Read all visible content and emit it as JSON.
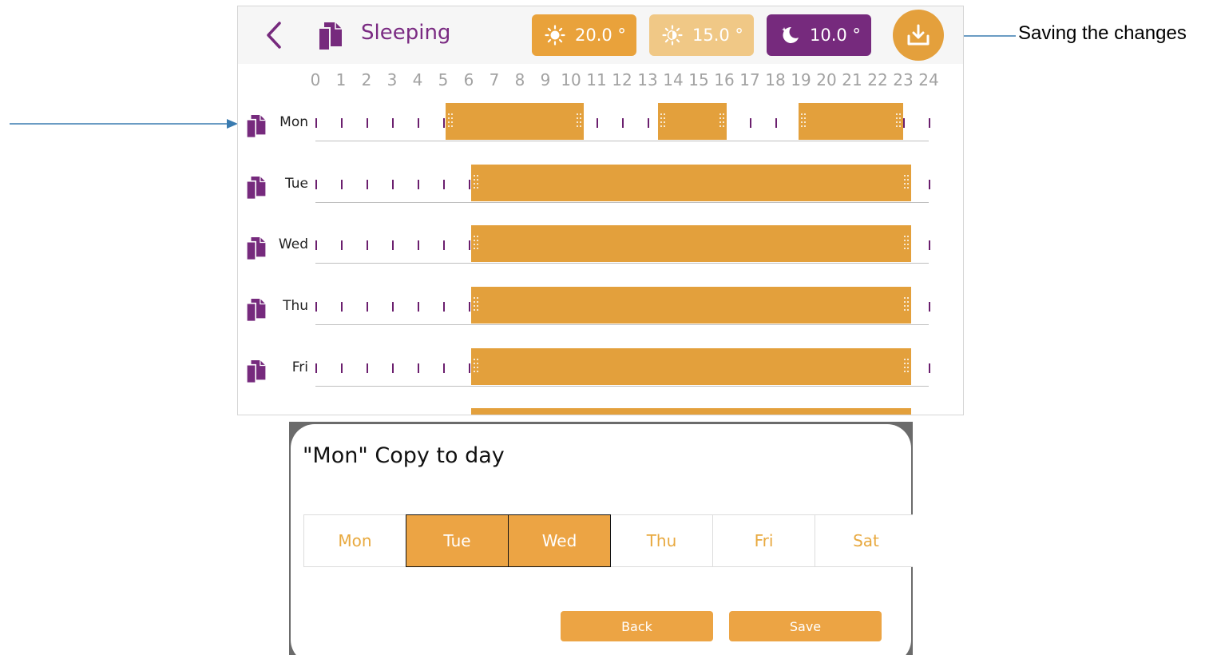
{
  "header": {
    "title": "Sleeping",
    "temps": [
      {
        "label": "20.0 °",
        "icon": "sun-icon",
        "color": "#e9a23b"
      },
      {
        "label": "15.0 °",
        "icon": "sun-dim-icon",
        "color": "#f0c886"
      },
      {
        "label": "10.0 °",
        "icon": "moon-icon",
        "color": "#762a7d"
      }
    ]
  },
  "hours": [
    "0",
    "1",
    "2",
    "3",
    "4",
    "5",
    "6",
    "7",
    "8",
    "9",
    "10",
    "11",
    "12",
    "13",
    "14",
    "15",
    "16",
    "17",
    "18",
    "19",
    "20",
    "21",
    "22",
    "23",
    "24"
  ],
  "days": [
    {
      "label": "Mon",
      "segments": [
        [
          5.1,
          10.5
        ],
        [
          13.4,
          16.1
        ],
        [
          18.9,
          23.0
        ]
      ]
    },
    {
      "label": "Tue",
      "segments": [
        [
          6.1,
          23.3
        ]
      ]
    },
    {
      "label": "Wed",
      "segments": [
        [
          6.1,
          23.3
        ]
      ]
    },
    {
      "label": "Thu",
      "segments": [
        [
          6.1,
          23.3
        ]
      ]
    },
    {
      "label": "Fri",
      "segments": [
        [
          6.1,
          23.3
        ]
      ]
    }
  ],
  "annotations": {
    "save": "Saving the changes"
  },
  "dialog": {
    "title": "\"Mon\" Copy to day",
    "days": [
      {
        "label": "Mon",
        "selected": false
      },
      {
        "label": "Tue",
        "selected": true
      },
      {
        "label": "Wed",
        "selected": true
      },
      {
        "label": "Thu",
        "selected": false
      },
      {
        "label": "Fri",
        "selected": false
      },
      {
        "label": "Sat",
        "selected": false
      }
    ],
    "back_label": "Back",
    "save_label": "Save"
  },
  "colors": {
    "accent": "#e3a03c",
    "purple": "#762a7d",
    "arrow": "#3a7bb0"
  }
}
